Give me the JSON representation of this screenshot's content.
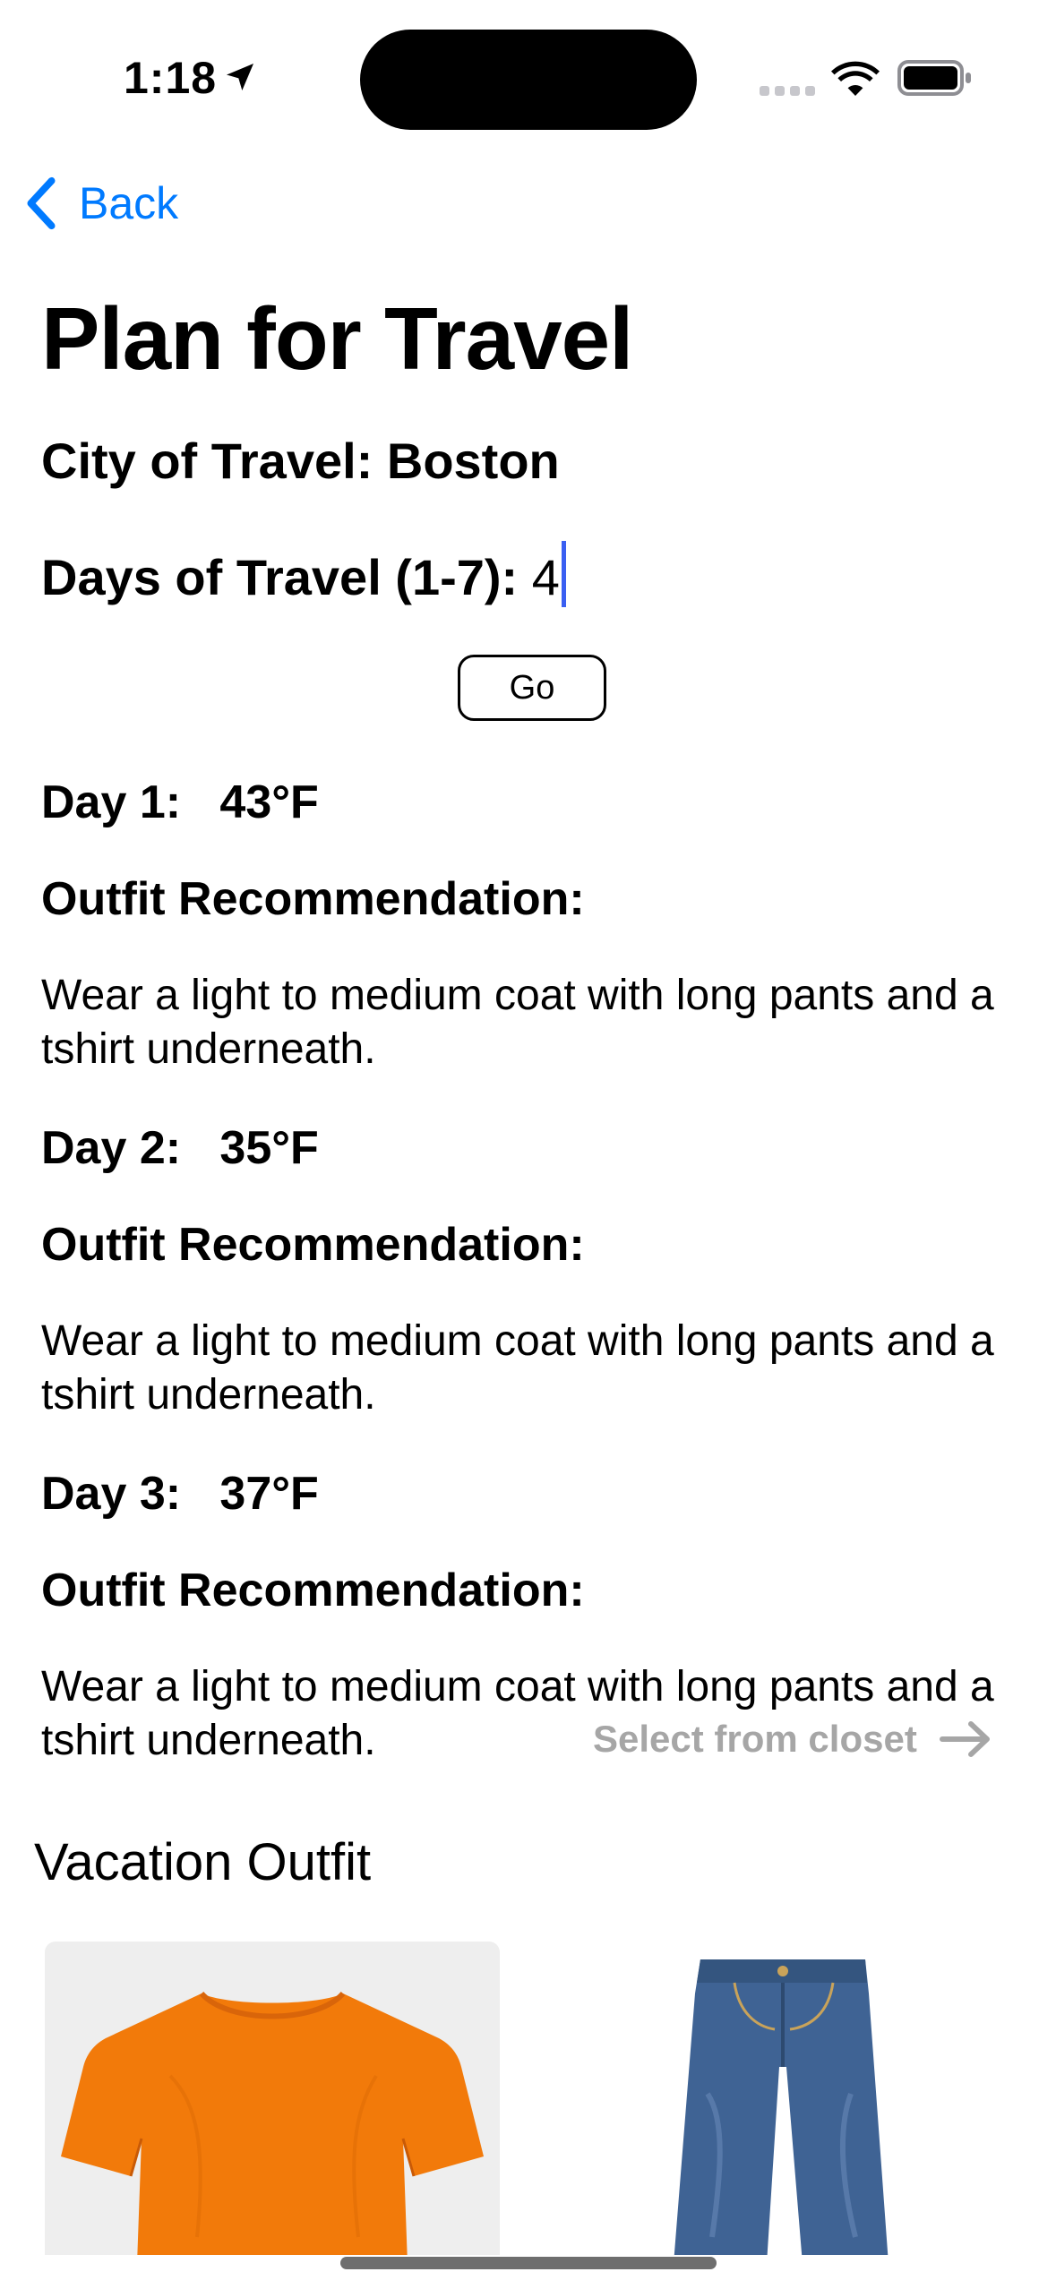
{
  "status_bar": {
    "time": "1:18",
    "icons": [
      "location-arrow-icon",
      "cellular-signal-icon",
      "wifi-icon",
      "battery-icon"
    ]
  },
  "nav": {
    "back_label": "Back",
    "accent_color": "#007aff"
  },
  "page": {
    "title": "Plan for Travel",
    "city_label": "City of Travel: Boston",
    "days_label": "Days of Travel (1-7): ",
    "days_value": "4",
    "go_label": "Go"
  },
  "forecast": [
    {
      "day_label": "Day 1:   43°F",
      "rec_label": "Outfit Recommendation:",
      "rec_text": "Wear a light to medium coat with long pants and a tshirt underneath."
    },
    {
      "day_label": "Day 2:   35°F",
      "rec_label": "Outfit Recommendation:",
      "rec_text": "Wear a light to medium coat with long pants and a tshirt underneath."
    },
    {
      "day_label": "Day 3:   37°F",
      "rec_label": "Outfit Recommendation:",
      "rec_text": "Wear a light to medium coat with long pants and a tshirt underneath."
    }
  ],
  "closet": {
    "select_label": "Select from closet",
    "section_title": "Vacation Outfit",
    "items": [
      {
        "name": "orange-tshirt",
        "color": "#f27a0a"
      },
      {
        "name": "blue-jeans",
        "color": "#3f6394"
      }
    ]
  }
}
